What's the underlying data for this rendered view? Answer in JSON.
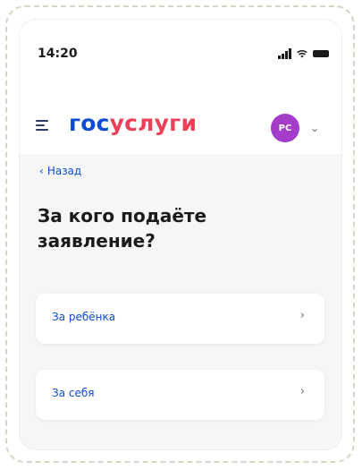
{
  "status_bar": {
    "time": "14:20"
  },
  "header": {
    "menu_icon": "hamburger-menu-icon",
    "logo_part1": "гос",
    "logo_part2": "услуги",
    "avatar_initials": "PC",
    "dropdown_icon": "chevron-down-icon"
  },
  "nav": {
    "back_label": "Назад"
  },
  "main": {
    "title": "За кого подаёте заявление?",
    "options": [
      {
        "label": "За ребёнка"
      },
      {
        "label": "За себя"
      }
    ]
  },
  "colors": {
    "brand_blue": "#0d4cd3",
    "brand_red": "#ee3f58",
    "avatar": "#a33cc8",
    "background": "#f5f6f8"
  }
}
